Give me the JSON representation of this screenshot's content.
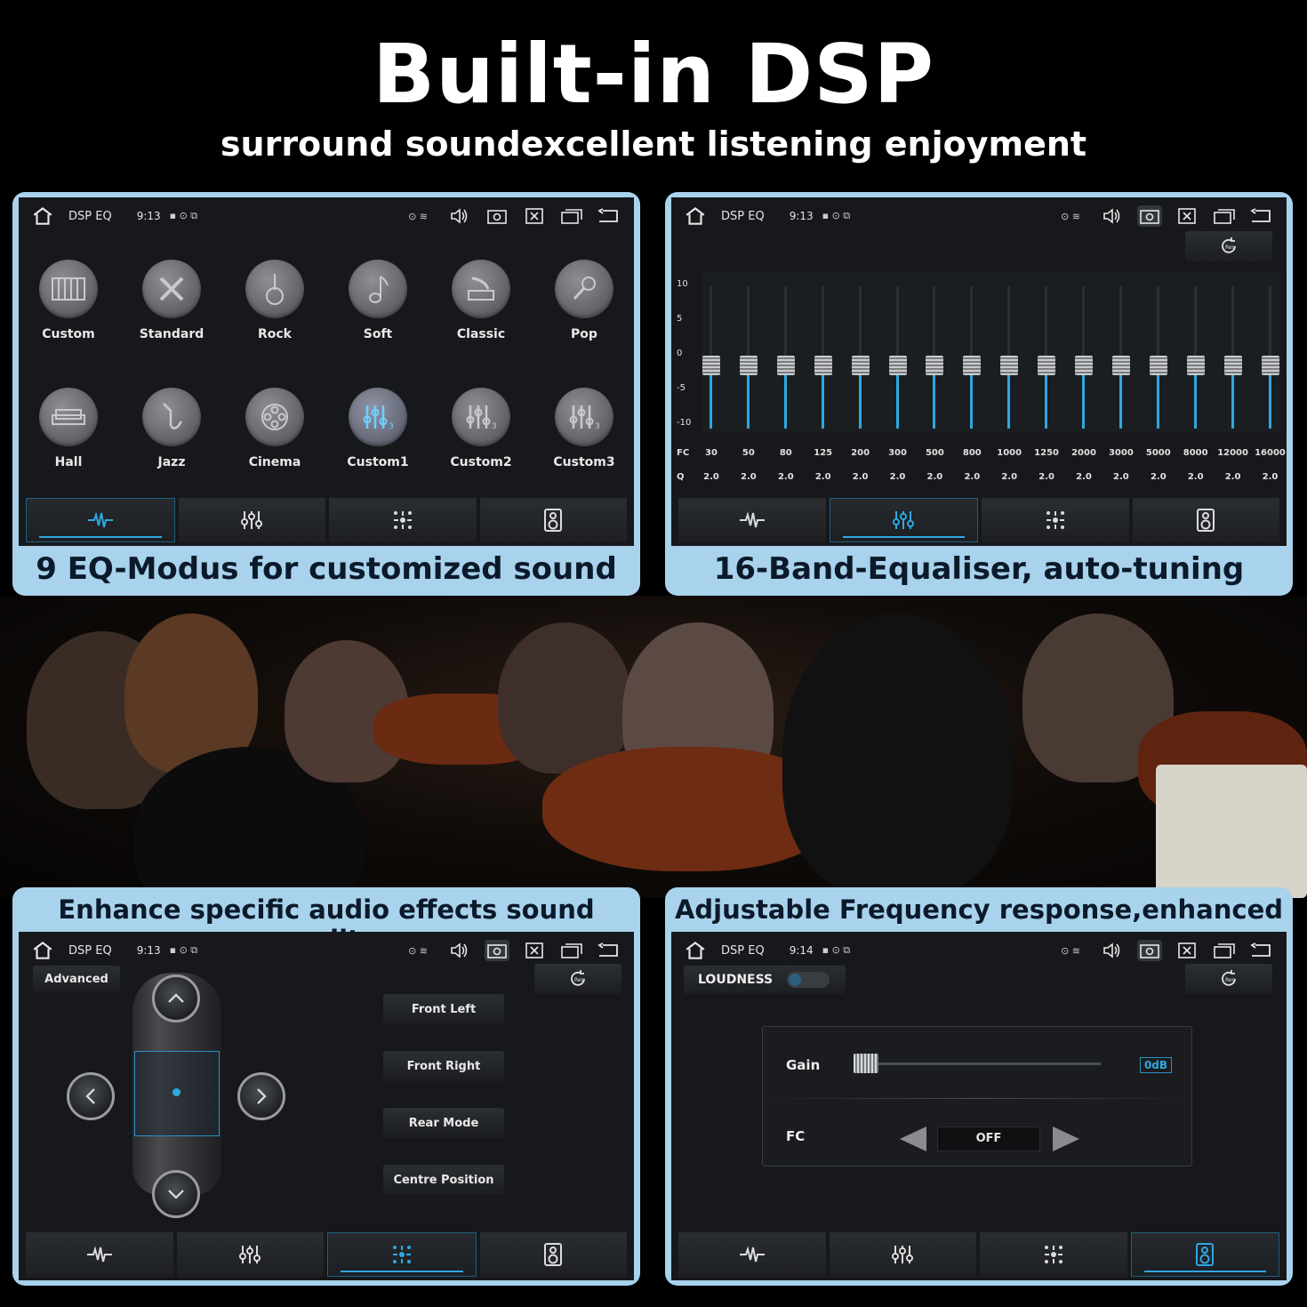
{
  "header": {
    "title": "Built-in DSP",
    "subtitle": "surround soundexcellent listening enjoyment"
  },
  "colors": {
    "accent": "#2fa8e0",
    "frame": "#a9d2ec",
    "screen": "#16181b"
  },
  "panels": [
    {
      "status": {
        "app": "DSP EQ",
        "time": "9:13"
      },
      "caption": "9 EQ-Modus for customized sound",
      "presets": [
        {
          "label": "Custom",
          "icon": "piano-icon"
        },
        {
          "label": "Standard",
          "icon": "tools-icon"
        },
        {
          "label": "Rock",
          "icon": "guitar-icon"
        },
        {
          "label": "Soft",
          "icon": "music-note-icon"
        },
        {
          "label": "Classic",
          "icon": "gramophone-icon"
        },
        {
          "label": "Pop",
          "icon": "microphone-icon"
        },
        {
          "label": "Hall",
          "icon": "sofa-icon"
        },
        {
          "label": "Jazz",
          "icon": "saxophone-icon"
        },
        {
          "label": "Cinema",
          "icon": "film-reel-icon"
        },
        {
          "label": "Custom1",
          "icon": "sliders-1-icon"
        },
        {
          "label": "Custom2",
          "icon": "sliders-2-icon"
        },
        {
          "label": "Custom3",
          "icon": "sliders-3-icon"
        }
      ],
      "active_tab": 0
    },
    {
      "status": {
        "app": "DSP EQ",
        "time": "9:13"
      },
      "caption": "16-Band-Equaliser, auto-tuning",
      "y_ticks": [
        "10",
        "5",
        "0",
        "-5",
        "-10"
      ],
      "fc_label": "FC",
      "q_label": "Q",
      "bands": [
        {
          "fc": "30",
          "q": "2.0",
          "gain": 0
        },
        {
          "fc": "50",
          "q": "2.0",
          "gain": 0
        },
        {
          "fc": "80",
          "q": "2.0",
          "gain": 0
        },
        {
          "fc": "125",
          "q": "2.0",
          "gain": 0
        },
        {
          "fc": "200",
          "q": "2.0",
          "gain": 0
        },
        {
          "fc": "300",
          "q": "2.0",
          "gain": 0
        },
        {
          "fc": "500",
          "q": "2.0",
          "gain": 0
        },
        {
          "fc": "800",
          "q": "2.0",
          "gain": 0
        },
        {
          "fc": "1000",
          "q": "2.0",
          "gain": 0
        },
        {
          "fc": "1250",
          "q": "2.0",
          "gain": 0
        },
        {
          "fc": "2000",
          "q": "2.0",
          "gain": 0
        },
        {
          "fc": "3000",
          "q": "2.0",
          "gain": 0
        },
        {
          "fc": "5000",
          "q": "2.0",
          "gain": 0
        },
        {
          "fc": "8000",
          "q": "2.0",
          "gain": 0
        },
        {
          "fc": "12000",
          "q": "2.0",
          "gain": 0
        },
        {
          "fc": "16000",
          "q": "2.0",
          "gain": 0
        }
      ],
      "active_tab": 1
    },
    {
      "status": {
        "app": "DSP EQ",
        "time": "9:13"
      },
      "caption": "Enhance specific audio effects sound quality",
      "advanced_label": "Advanced",
      "positions": [
        "Front Left",
        "Front Right",
        "Rear Mode",
        "Centre Position"
      ],
      "active_tab": 2
    },
    {
      "status": {
        "app": "DSP EQ",
        "time": "9:14"
      },
      "caption": "Adjustable Frequency response,enhanced",
      "loudness_label": "LOUDNESS",
      "gain_label": "Gain",
      "gain_value": "0dB",
      "fc_label": "FC",
      "fc_value": "OFF",
      "active_tab": 3
    }
  ]
}
